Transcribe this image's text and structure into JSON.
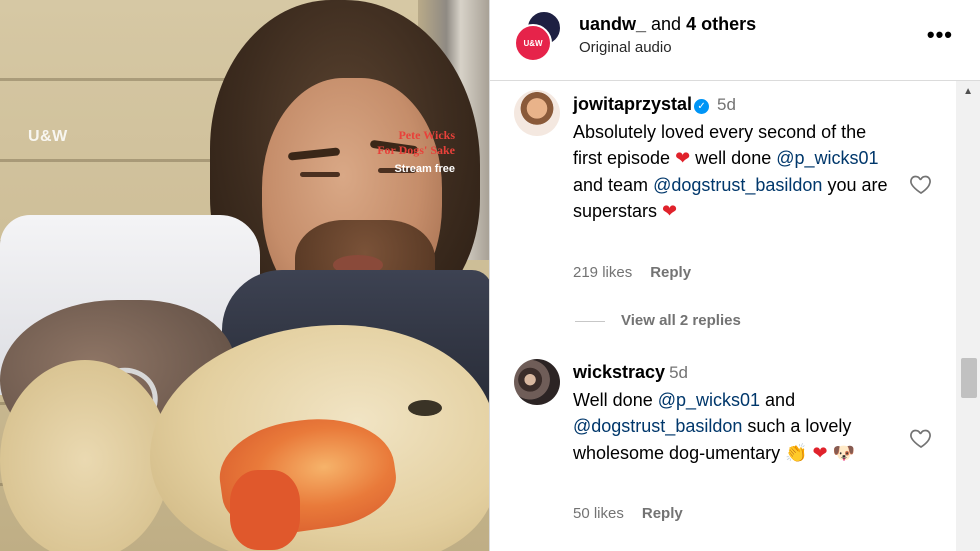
{
  "media": {
    "logo": "U&W",
    "show_title_line1": "Pete Wicks",
    "show_title_line2": "For Dogs' Sake",
    "stream_text": "Stream free"
  },
  "header": {
    "avatar_text": "U&W",
    "username": "uandw_",
    "and_text": "and",
    "others": "4 others",
    "audio": "Original audio",
    "more_icon": "more-horizontal-icon"
  },
  "comments": [
    {
      "username": "jowitaprzystal",
      "verified": true,
      "time": "5d",
      "text_parts": [
        "Absolutely loved every second of the first episode ",
        "❤",
        " well done ",
        "@p_wicks01",
        " and team ",
        "@dogstrust_basildon",
        " you are superstars ",
        "❤"
      ],
      "likes": "219 likes",
      "reply": "Reply",
      "view_replies": "View all 2 replies"
    },
    {
      "username": "wickstracy",
      "time": "5d",
      "text_parts": [
        "Well done ",
        "@p_wicks01",
        " and ",
        "@dogstrust_basildon",
        " such a lovely wholesome dog-umentary ",
        "👏",
        " ",
        "❤",
        " ",
        "🐶"
      ],
      "likes": "50 likes",
      "reply": "Reply"
    }
  ],
  "colors": {
    "mention": "#00376b",
    "heart": "#e0222b",
    "verified": "#0095f6",
    "brand_red": "#e6234a"
  }
}
